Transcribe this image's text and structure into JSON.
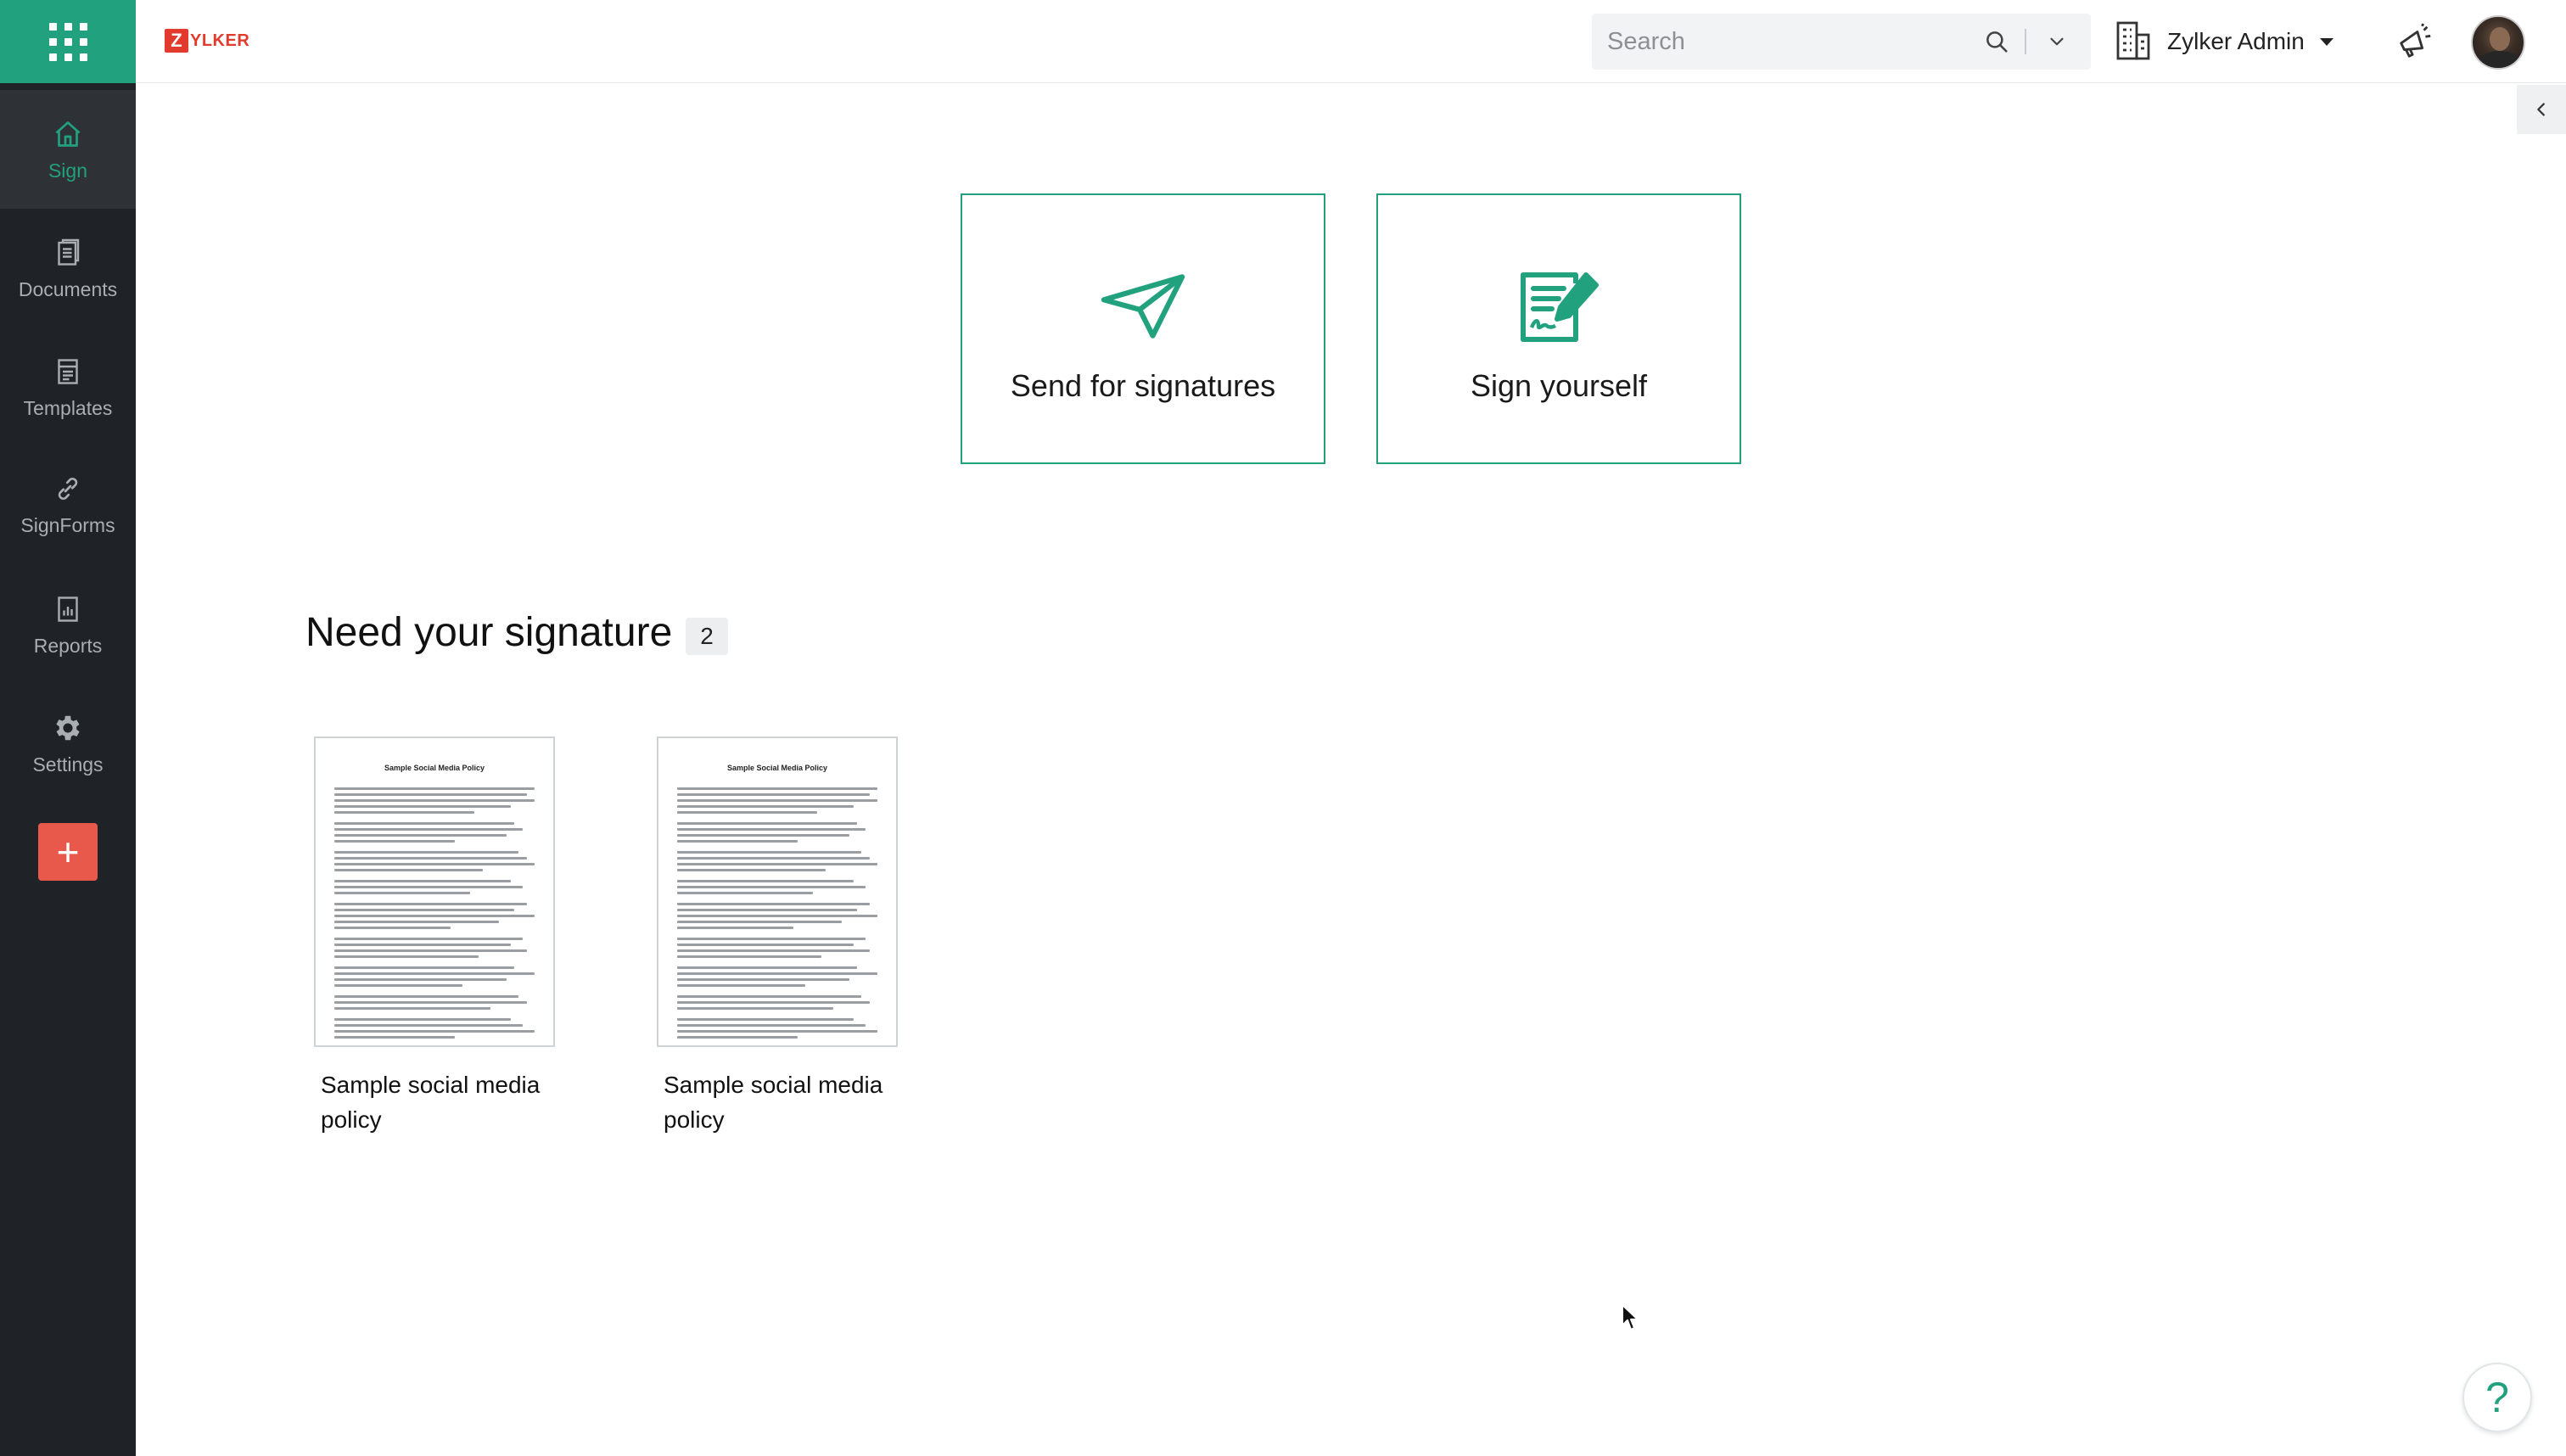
{
  "brand": {
    "logo_letter": "Z",
    "logo_text": "YLKER",
    "accent": "#21a17d",
    "logo_color": "#e23b2e"
  },
  "sidebar": {
    "items": [
      {
        "label": "Sign",
        "icon": "home-icon",
        "active": true
      },
      {
        "label": "Documents",
        "icon": "documents-icon"
      },
      {
        "label": "Templates",
        "icon": "templates-icon"
      },
      {
        "label": "SignForms",
        "icon": "link-icon"
      },
      {
        "label": "Reports",
        "icon": "reports-icon"
      },
      {
        "label": "Settings",
        "icon": "gear-icon"
      }
    ],
    "add_label": "+"
  },
  "header": {
    "search": {
      "placeholder": "Search"
    },
    "org_name": "Zylker Admin"
  },
  "actions": {
    "send_label": "Send for signatures",
    "self_label": "Sign yourself"
  },
  "section": {
    "title": "Need your signature",
    "count": "2",
    "documents": [
      {
        "name": "Sample social media policy",
        "preview_title": "Sample Social Media Policy"
      },
      {
        "name": "Sample social media policy",
        "preview_title": "Sample Social Media Policy"
      }
    ]
  },
  "help_label": "?"
}
